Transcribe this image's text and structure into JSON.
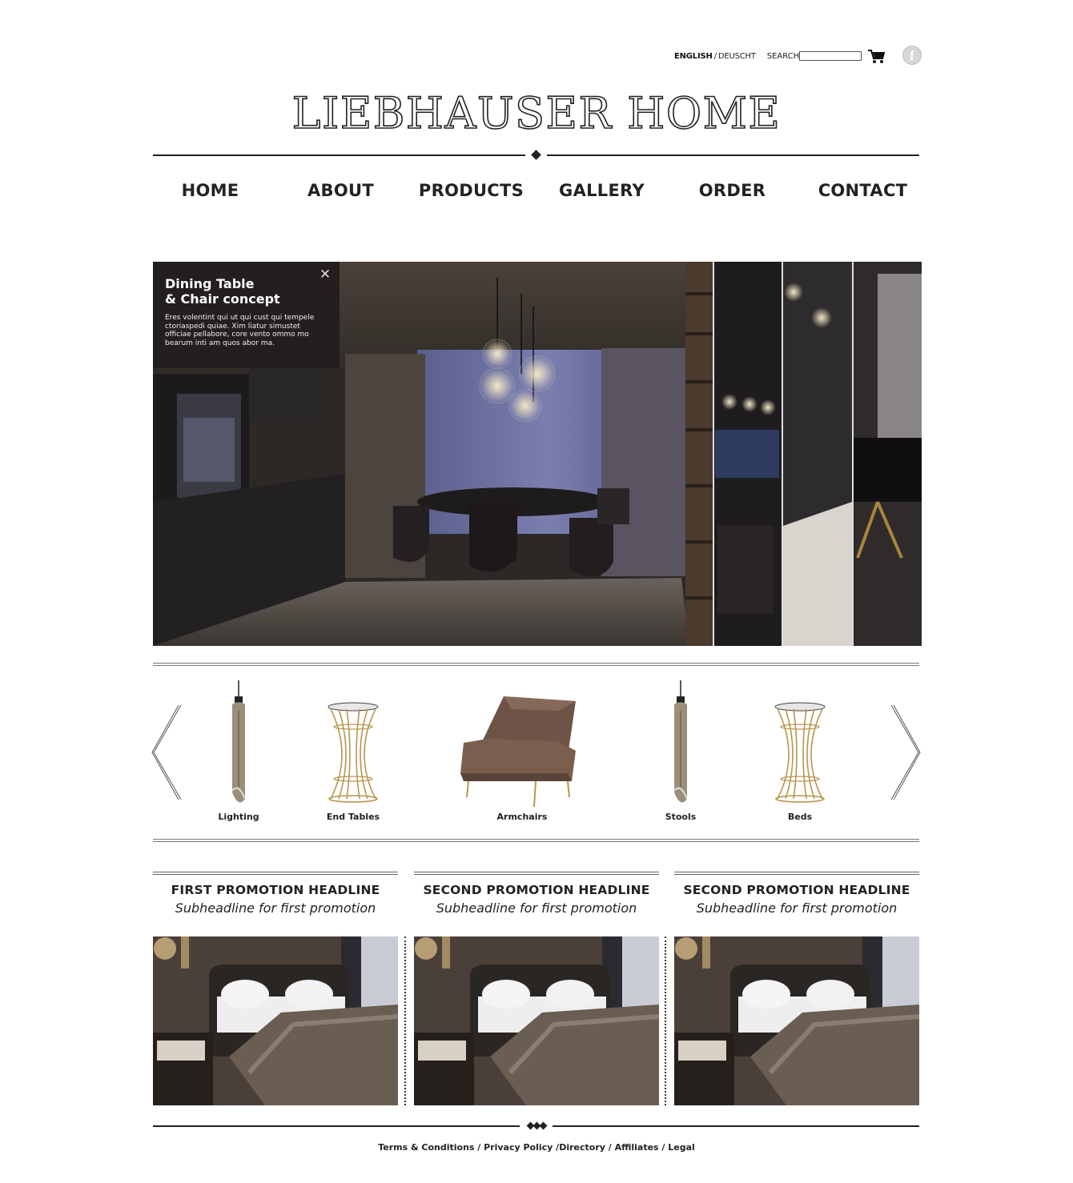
{
  "topbar": {
    "lang_active": "ENGLISH",
    "lang_sep": "/",
    "lang_other": "DEUSCHT",
    "search_label": "SEARCH",
    "search_value": "",
    "cart_icon": "cart-icon",
    "facebook_icon": "facebook-icon",
    "facebook_glyph": "f"
  },
  "logo": "LIEBHAUSER HOME",
  "nav": [
    "HOME",
    "ABOUT",
    "PRODUCTS",
    "GALLERY",
    "ORDER",
    "CONTACT"
  ],
  "hero": {
    "title_line1": "Dining Table",
    "title_line2": "& Chair concept",
    "body": "Eres volentint qui ut qui cust qui tempele ctoriaspedi quiae. Xim liatur simustet officiae pellabore, core vento ommo mo bearum inti am quos abor ma.",
    "close_icon": "close-icon",
    "close_glyph": "✕"
  },
  "products": [
    {
      "label": "Lighting",
      "icon": "pendant-lamp-icon"
    },
    {
      "label": "End Tables",
      "icon": "end-table-icon"
    },
    {
      "label": "Armchairs",
      "icon": "armchair-icon"
    },
    {
      "label": "Stools",
      "icon": "pendant-lamp-icon"
    },
    {
      "label": "Beds",
      "icon": "end-table-icon"
    }
  ],
  "promos": [
    {
      "headline": "FIRST PROMOTION HEADLINE",
      "subheadline": "Subheadline for first promotion"
    },
    {
      "headline": "SECOND PROMOTION HEADLINE",
      "subheadline": "Subheadline for first promotion"
    },
    {
      "headline": "SECOND PROMOTION HEADLINE",
      "subheadline": "Subheadline for first promotion"
    }
  ],
  "footer": {
    "links": "Terms & Conditions / Privacy Policy /Directory / Affiliates / Legal"
  },
  "colors": {
    "text": "#222222",
    "hero_box": "#231f1f",
    "brass": "#b8964f"
  }
}
